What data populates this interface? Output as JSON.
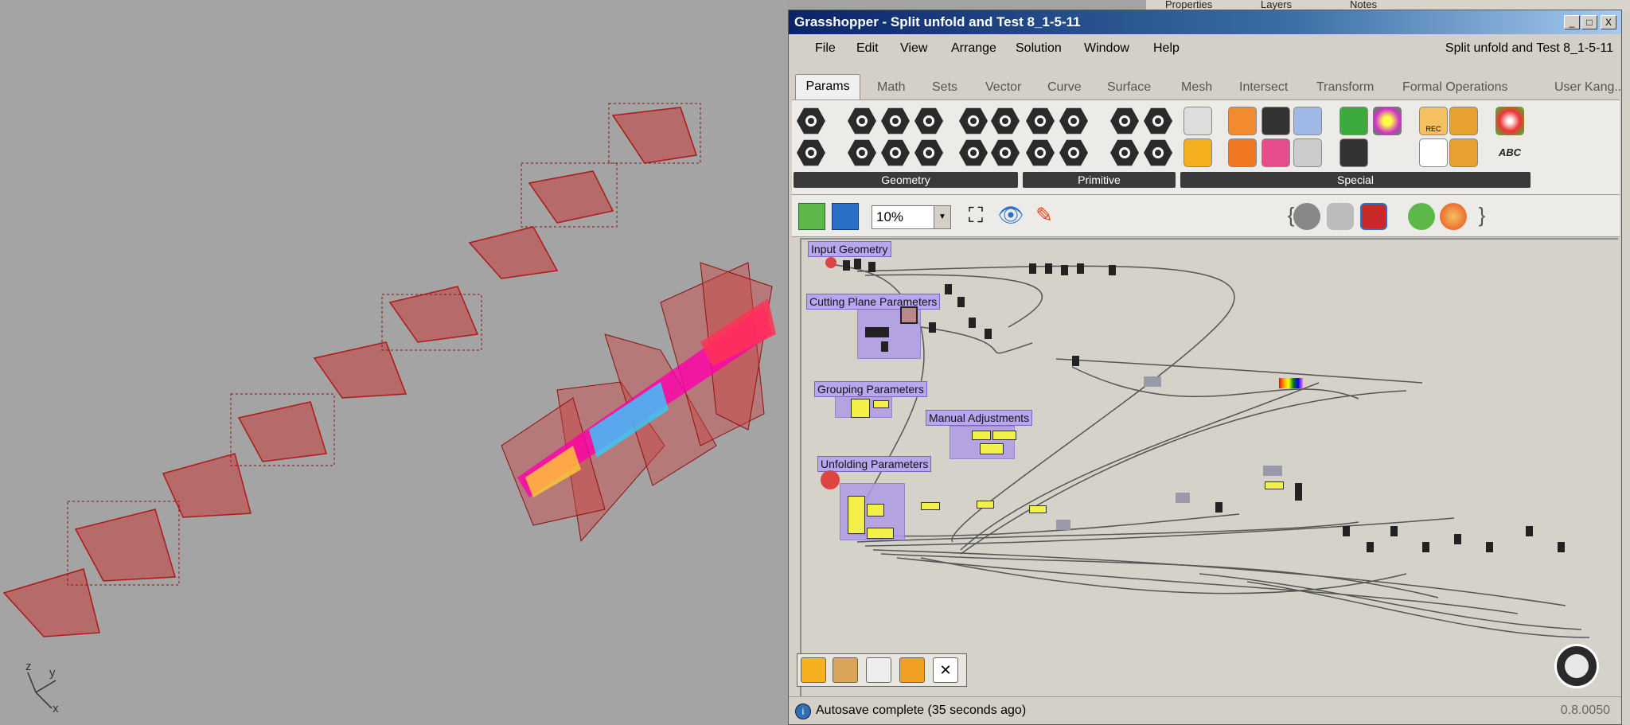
{
  "rhino_panel_tabs": [
    "Properties",
    "Layers",
    "Notes"
  ],
  "viewport": {
    "axis_labels": {
      "z": "z",
      "y": "y",
      "x": "x"
    }
  },
  "window": {
    "title": "Grasshopper - Split unfold and Test 8_1-5-11",
    "buttons": [
      "_",
      "□",
      "X"
    ]
  },
  "menu": {
    "items": [
      "File",
      "Edit",
      "View",
      "Arrange",
      "Solution",
      "Window",
      "Help"
    ],
    "document_name": "Split unfold and Test 8_1-5-11"
  },
  "tabs": {
    "items": [
      "Params",
      "Math",
      "Sets",
      "Vector",
      "Curve",
      "Surface",
      "Mesh",
      "Intersect",
      "Transform",
      "Formal Operations",
      "User",
      "Kang..."
    ],
    "active": "Params"
  },
  "ribbon": {
    "panels": [
      "Geometry",
      "Primitive",
      "Special"
    ],
    "abc_label": "ABC",
    "rec_label": "REC"
  },
  "toolbar": {
    "zoom": "10%"
  },
  "canvas": {
    "groups": [
      "Input Geometry",
      "Cutting Plane Parameters",
      "Grouping Parameters",
      "Manual Adjustments",
      "Unfolding Parameters"
    ]
  },
  "status": {
    "message": "Autosave complete (35 seconds ago)",
    "version": "0.8.0050"
  },
  "colors": {
    "title_start": "#0a246a",
    "group_fill": "#b09be6",
    "panel_yellow": "#f4f04a",
    "unfold_red": "#c0392b"
  }
}
